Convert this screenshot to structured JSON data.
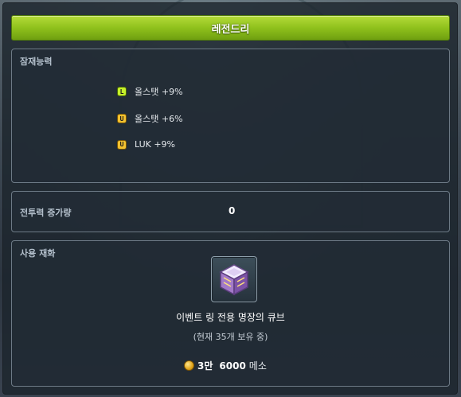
{
  "title": "레전드리",
  "potential": {
    "label": "잠재능력",
    "options": [
      {
        "grade": "L",
        "grade_color": "#c6f02a",
        "text": "올스탯 +9%"
      },
      {
        "grade": "U",
        "grade_color": "#f4c230",
        "text": "올스탯 +6%"
      },
      {
        "grade": "U",
        "grade_color": "#f4c230",
        "text": "LUK +9%"
      }
    ]
  },
  "combat_power": {
    "label": "전투력 증가량",
    "value": "0"
  },
  "material": {
    "label": "사용 재화",
    "item_icon": "cube-icon",
    "item_name": "이벤트 링 전용 명장의 큐브",
    "owned_text": "(현재 35개 보유 중)",
    "price_man": "3만",
    "price_rest": "6000",
    "price_unit": "메소"
  },
  "colors": {
    "title_bar": "#8fc11c",
    "panel_bg": "#1c242c",
    "section_border": "#6d7a86",
    "coin": "#e0a41a"
  }
}
